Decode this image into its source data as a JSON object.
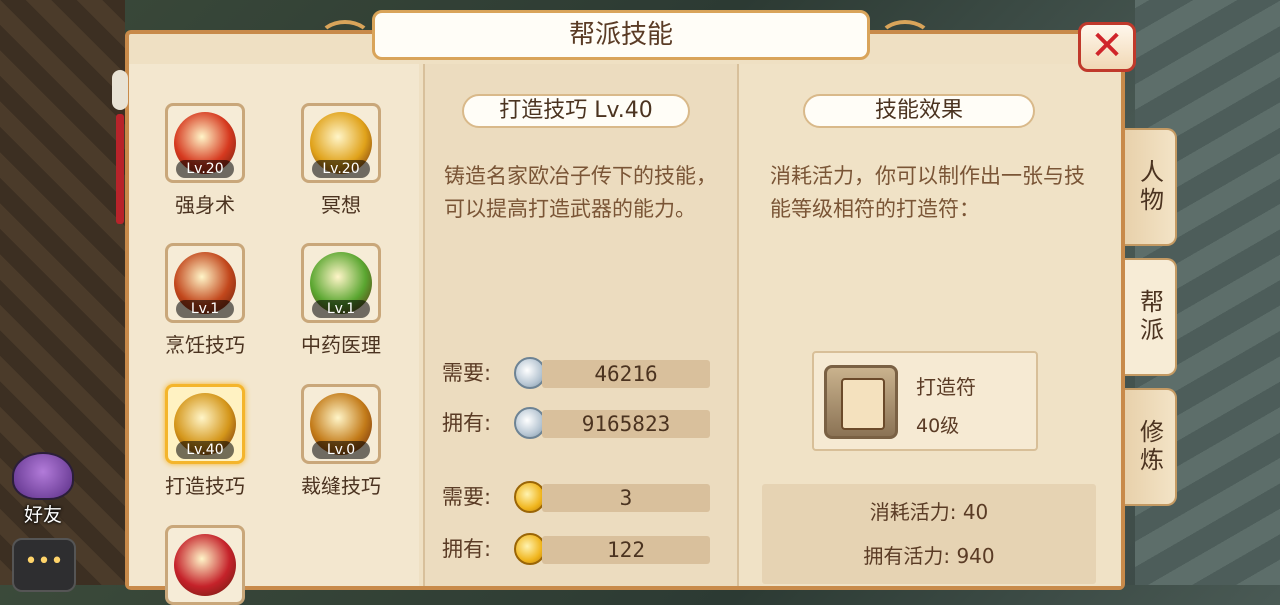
{
  "window": {
    "title": "帮派技能",
    "close_icon": "close-icon"
  },
  "friend": {
    "label": "好友"
  },
  "skills": [
    {
      "name": "强身术",
      "level": "Lv.20",
      "color": "#d6391f"
    },
    {
      "name": "冥想",
      "level": "Lv.20",
      "color": "#e0a21a"
    },
    {
      "name": "烹饪技巧",
      "level": "Lv.1",
      "color": "#c2471c"
    },
    {
      "name": "中药医理",
      "level": "Lv.1",
      "color": "#5aa630"
    },
    {
      "name": "打造技巧",
      "level": "Lv.40",
      "color": "#d4961a",
      "selected": true
    },
    {
      "name": "裁缝技巧",
      "level": "Lv.0",
      "color": "#c37b19"
    },
    {
      "name": "",
      "level": "",
      "color": "#c5222a"
    }
  ],
  "detail": {
    "title": "打造技巧 Lv.40",
    "description": "铸造名家欧冶子传下的技能，可以提高打造武器的能力。",
    "costs": [
      {
        "label": "需要:",
        "currency": "silver-coin-icon",
        "value": "46216"
      },
      {
        "label": "拥有:",
        "currency": "silver-coin-icon",
        "value": "9165823"
      },
      {
        "label": "需要:",
        "currency": "gold-coin-icon",
        "value": "3"
      },
      {
        "label": "拥有:",
        "currency": "gold-coin-icon",
        "value": "122"
      }
    ]
  },
  "effect": {
    "title": "技能效果",
    "description": "消耗活力，你可以制作出一张与技能等级相符的打造符：",
    "item": {
      "name": "打造符",
      "level": "40级",
      "icon": "scroll-icon"
    },
    "energy_cost": "消耗活力: 40",
    "energy_owned": "拥有活力: 940"
  },
  "side_tabs": [
    {
      "label": "人物",
      "active": false
    },
    {
      "label": "帮派",
      "active": true
    },
    {
      "label": "修炼",
      "active": false
    }
  ]
}
